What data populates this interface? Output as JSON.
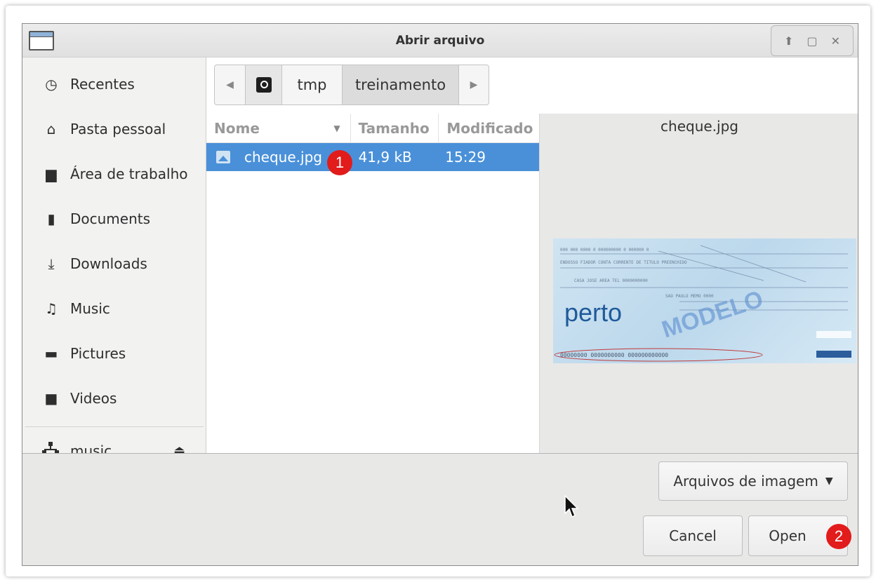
{
  "window": {
    "title": "Abrir arquivo",
    "controls": {
      "up": "⬆",
      "maximize": "▢",
      "close": "✕"
    }
  },
  "sidebar": {
    "items": [
      {
        "label": "Recentes",
        "icon": "clock-icon",
        "glyph": "◷"
      },
      {
        "label": "Pasta pessoal",
        "icon": "home-icon",
        "glyph": "⌂"
      },
      {
        "label": "Área de trabalho",
        "icon": "desktop-icon",
        "glyph": "▆"
      },
      {
        "label": "Documents",
        "icon": "document-icon",
        "glyph": "▮"
      },
      {
        "label": "Downloads",
        "icon": "download-icon",
        "glyph": "⤓"
      },
      {
        "label": "Music",
        "icon": "music-icon",
        "glyph": "♫"
      },
      {
        "label": "Pictures",
        "icon": "picture-icon",
        "glyph": "▬"
      },
      {
        "label": "Videos",
        "icon": "video-icon",
        "glyph": "■"
      }
    ],
    "partial_item": {
      "label": "music",
      "icon": "network-icon",
      "eject_glyph": "⏏"
    }
  },
  "pathbar": {
    "back": "◀",
    "segments": [
      "tmp",
      "treinamento"
    ],
    "forward": "▶"
  },
  "filelist": {
    "columns": [
      "Nome",
      "Tamanho",
      "Modificado"
    ],
    "rows": [
      {
        "name": "cheque.jpg",
        "size": "41,9 kB",
        "modified": "15:29",
        "selected": true
      }
    ]
  },
  "preview": {
    "filename": "cheque.jpg",
    "watermark": "MODELO",
    "logo": "perto"
  },
  "filter": {
    "label": "Arquivos de imagem",
    "caret": "▼"
  },
  "buttons": {
    "cancel": "Cancel",
    "open": "Open"
  },
  "annotations": {
    "step1": "1",
    "step2": "2"
  },
  "colors": {
    "selection": "#4a90d9",
    "badge": "#e21b1b"
  }
}
